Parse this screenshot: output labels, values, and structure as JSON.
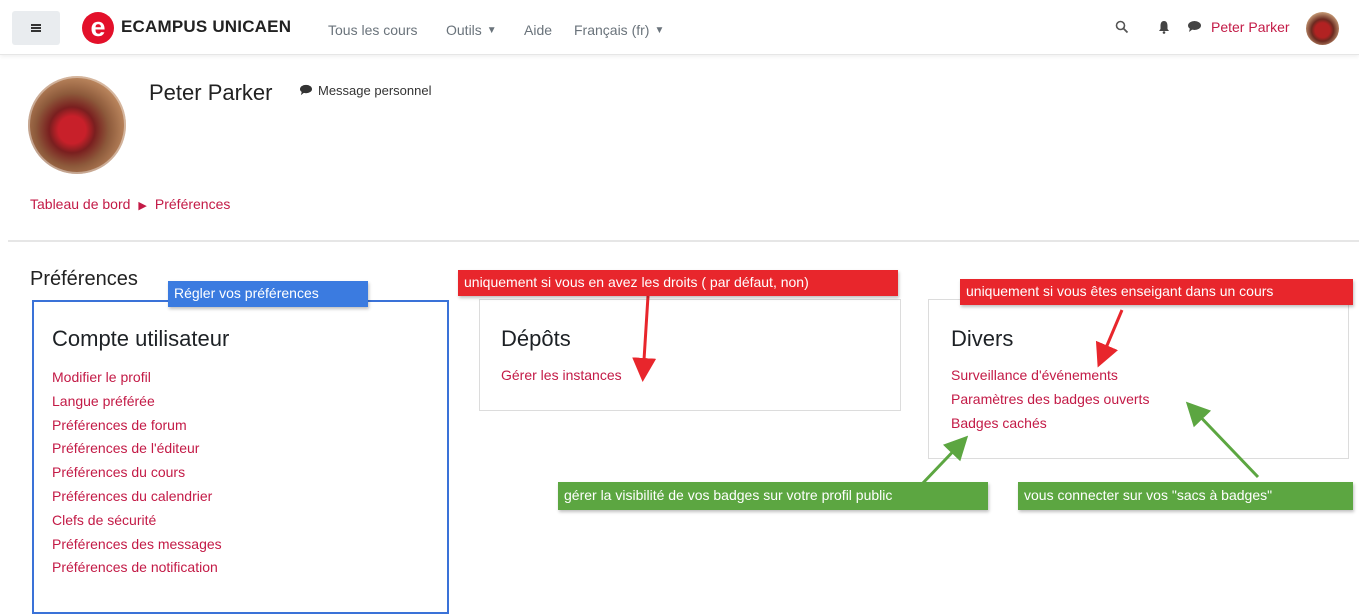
{
  "navbar": {
    "brand": "ECAMPUS UNICAEN",
    "links": [
      "Tous les cours",
      "Outils",
      "Aide",
      "Français (fr)"
    ],
    "user_name": "Peter Parker",
    "icons": [
      "menu-icon",
      "search-icon",
      "bell-icon",
      "message-icon"
    ]
  },
  "profile": {
    "name": "Peter Parker",
    "message_link": "Message personnel"
  },
  "breadcrumb": {
    "items": [
      "Tableau de bord",
      "Préférences"
    ]
  },
  "page": {
    "title": "Préférences"
  },
  "cards": {
    "user": {
      "title": "Compte utilisateur",
      "links": [
        "Modifier le profil",
        "Langue préférée",
        "Préférences de forum",
        "Préférences de l'éditeur",
        "Préférences du cours",
        "Préférences du calendrier",
        "Clefs de sécurité",
        "Préférences des messages",
        "Préférences de notification"
      ]
    },
    "depots": {
      "title": "Dépôts",
      "links": [
        "Gérer les instances"
      ]
    },
    "divers": {
      "title": "Divers",
      "links": [
        "Surveillance d'événements",
        "Paramètres des badges ouverts",
        "Badges cachés"
      ]
    }
  },
  "annotations": {
    "blue": "Régler vos préférences",
    "red1": "uniquement si vous en avez les droits ( par défaut, non)",
    "red2": "uniquement si vous êtes enseigant dans un cours",
    "green1": "gérer la visibilité de vos badges sur votre profil public",
    "green2": "vous connecter sur vos \"sacs à badges\""
  },
  "colors": {
    "link": "#c31a46",
    "annotation_red": "#e8262c",
    "annotation_green": "#5ca641",
    "annotation_blue": "#3b7be0"
  }
}
